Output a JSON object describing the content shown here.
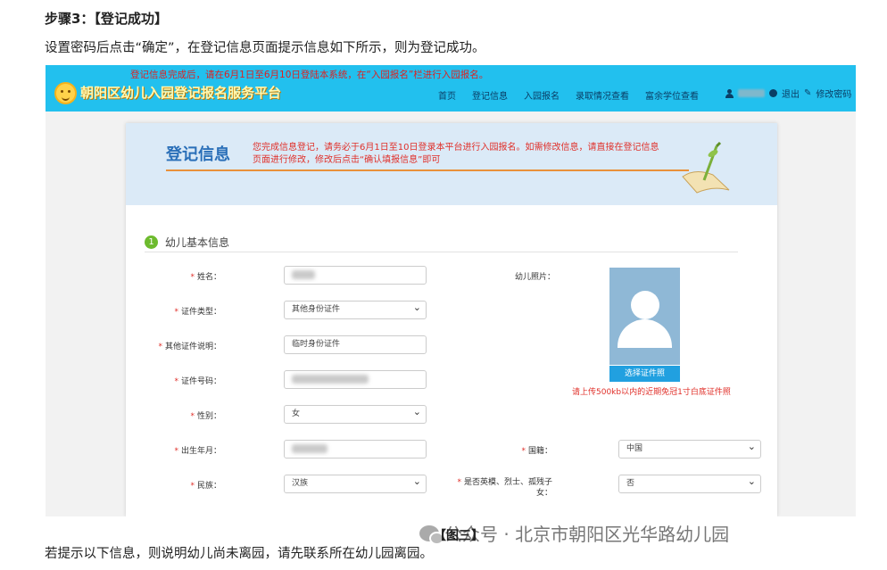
{
  "doc": {
    "heading": "步骤3：【登记成功】",
    "intro": "设置密码后点击“确定”，在登记信息页面提示信息如下所示，则为登记成功。",
    "figure_caption": "【图三】",
    "bottom_text": "若提示以下信息，则说明幼儿尚未离园，请先联系所在幼儿园离园。",
    "watermark": "公众号 · 北京市朝阳区光华路幼儿园"
  },
  "site": {
    "notice": "登记信息完成后，请在6月1日至6月10日登陆本系统，在“入园报名”栏进行入园报名。",
    "title": "朝阳区幼儿入园登记报名服务平台",
    "nav": [
      "首页",
      "登记信息",
      "入园报名",
      "录取情况查看",
      "富余学位查看"
    ],
    "logout": "退出",
    "change_password": "修改密码",
    "colors": {
      "topbar": "#22c0ee",
      "accent": "#2a6fb8",
      "warning": "#e0302a"
    }
  },
  "card": {
    "title": "登记信息",
    "message": "您完成信息登记，请务必于6月1日至10日登录本平台进行入园报名。如需修改信息，请直接在登记信息页面进行修改，修改后点击“确认填报信息”即可"
  },
  "section": {
    "number": "1",
    "title": "幼儿基本信息"
  },
  "form": {
    "name_label": "姓名：",
    "id_type_label": "证件类型：",
    "id_type_value": "其他身份证件",
    "other_id_label": "其他证件说明：",
    "other_id_value": "临时身份证件",
    "id_number_label": "证件号码：",
    "gender_label": "性别：",
    "gender_value": "女",
    "birth_label": "出生年月：",
    "nation_label": "国籍：",
    "nation_value": "中国",
    "ethnicity_label": "民族：",
    "ethnicity_value": "汉族",
    "martyr_label_1": "是否英模、烈士、孤残子",
    "martyr_label_2": "女：",
    "martyr_value": "否",
    "photo_label": "幼儿照片：",
    "photo_button": "选择证件照",
    "photo_hint": "请上传500kb以内的近期免冠1寸白底证件照"
  }
}
